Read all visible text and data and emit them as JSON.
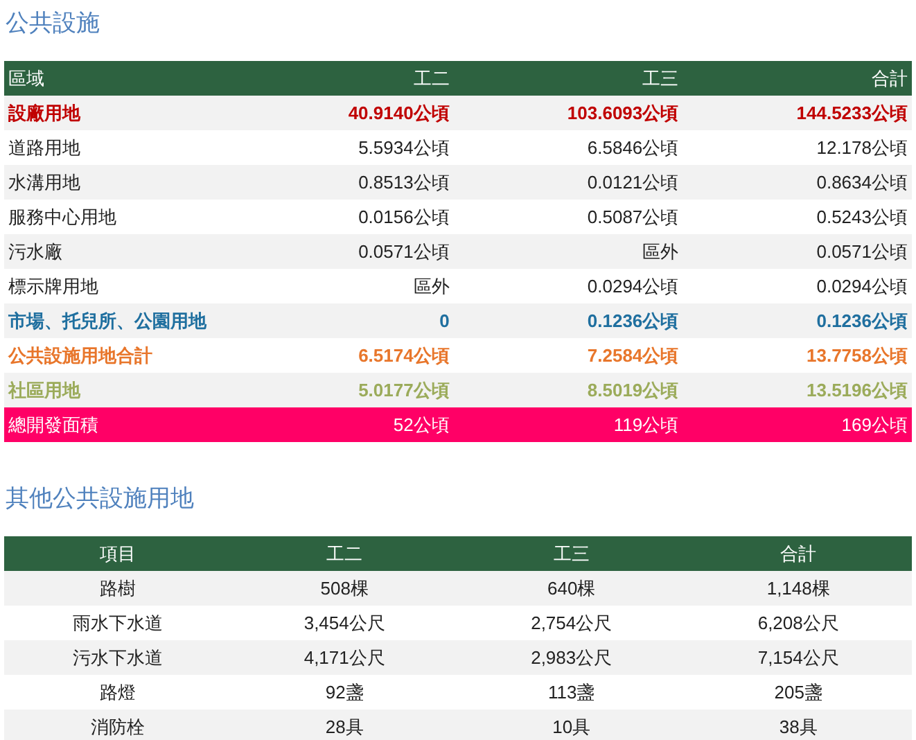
{
  "sections": [
    {
      "title": "公共設施",
      "kind": "right_aligned",
      "columns": [
        "區域",
        "工二",
        "工三",
        "合計"
      ],
      "rows": [
        {
          "kind": "red",
          "cells": [
            "設廠用地",
            "40.9140公頃",
            "103.6093公頃",
            "144.5233公頃"
          ]
        },
        {
          "kind": "plain",
          "cells": [
            "道路用地",
            "5.5934公頃",
            "6.5846公頃",
            "12.178公頃"
          ]
        },
        {
          "kind": "plain",
          "cells": [
            "水溝用地",
            "0.8513公頃",
            "0.0121公頃",
            "0.8634公頃"
          ]
        },
        {
          "kind": "plain",
          "cells": [
            "服務中心用地",
            "0.0156公頃",
            "0.5087公頃",
            "0.5243公頃"
          ]
        },
        {
          "kind": "plain",
          "cells": [
            "污水廠",
            "0.0571公頃",
            "區外",
            "0.0571公頃"
          ]
        },
        {
          "kind": "plain",
          "cells": [
            "標示牌用地",
            "區外",
            "0.0294公頃",
            "0.0294公頃"
          ]
        },
        {
          "kind": "blue",
          "cells": [
            "市場、托兒所、公園用地",
            "0",
            "0.1236公頃",
            "0.1236公頃"
          ]
        },
        {
          "kind": "orange",
          "cells": [
            "公共設施用地合計",
            "6.5174公頃",
            "7.2584公頃",
            "13.7758公頃"
          ]
        },
        {
          "kind": "olive",
          "cells": [
            "社區用地",
            "5.0177公頃",
            "8.5019公頃",
            "13.5196公頃"
          ]
        },
        {
          "kind": "total",
          "cells": [
            "總開發面積",
            "52公頃",
            "119公頃",
            "169公頃"
          ]
        }
      ]
    },
    {
      "title": "其他公共設施用地",
      "kind": "centered",
      "columns": [
        "項目",
        "工二",
        "工三",
        "合計"
      ],
      "rows": [
        {
          "kind": "plain",
          "cells": [
            "路樹",
            "508棵",
            "640棵",
            "1,148棵"
          ]
        },
        {
          "kind": "plain",
          "cells": [
            "雨水下水道",
            "3,454公尺",
            "2,754公尺",
            "6,208公尺"
          ]
        },
        {
          "kind": "plain",
          "cells": [
            "污水下水道",
            "4,171公尺",
            "2,983公尺",
            "7,154公尺"
          ]
        },
        {
          "kind": "plain",
          "cells": [
            "路燈",
            "92盞",
            "113盞",
            "205盞"
          ]
        },
        {
          "kind": "plain",
          "cells": [
            "消防栓",
            "28具",
            "10具",
            "38具"
          ]
        }
      ]
    }
  ]
}
